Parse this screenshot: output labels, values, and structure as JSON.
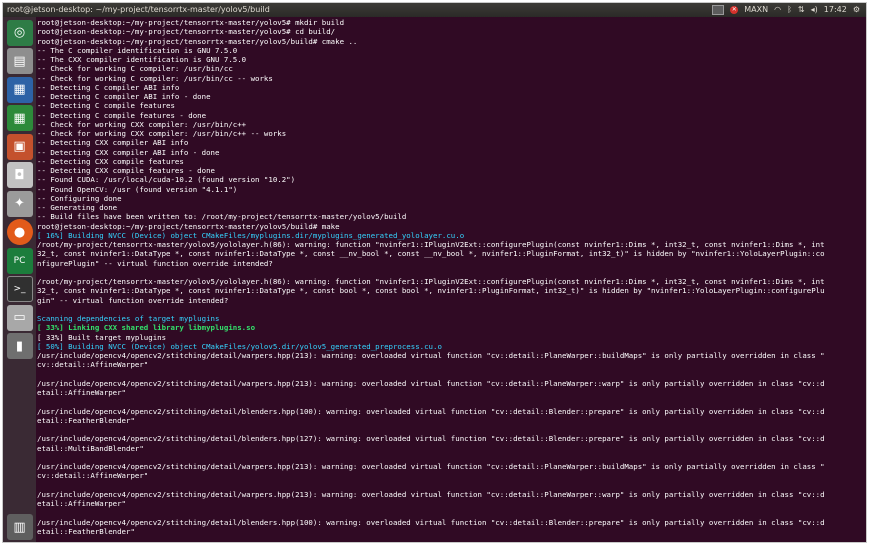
{
  "window": {
    "title": "root@jetson-desktop: ~/my-project/tensorrtx-master/yolov5/build"
  },
  "tray": {
    "mode": "MAXN",
    "time": "17:42",
    "icons": [
      "nvidia-icon",
      "red-status-icon",
      "wifi-icon",
      "bluetooth-icon",
      "keyboard-icon",
      "volume-icon",
      "gear-icon"
    ]
  },
  "launcher": [
    {
      "name": "ubuntu-logo-icon",
      "glyph": "◎"
    },
    {
      "name": "files-icon",
      "glyph": "▤"
    },
    {
      "name": "libreoffice-writer-icon",
      "glyph": "▦"
    },
    {
      "name": "libreoffice-calc-icon",
      "glyph": "▦"
    },
    {
      "name": "libreoffice-impress-icon",
      "glyph": "▣"
    },
    {
      "name": "software-center-icon",
      "glyph": "◘"
    },
    {
      "name": "system-settings-icon",
      "glyph": "✦"
    },
    {
      "name": "firefox-icon",
      "glyph": "●"
    },
    {
      "name": "pycharm-icon",
      "glyph": "PC"
    },
    {
      "name": "terminal-icon",
      "glyph": ">_"
    },
    {
      "name": "drive-icon",
      "glyph": "▭"
    },
    {
      "name": "usb-drive-icon",
      "glyph": "▮"
    },
    {
      "name": "trash-icon",
      "glyph": "▥"
    }
  ],
  "terminal": {
    "lines": [
      {
        "t": "root@jetson-desktop:~/my-project/tensorrtx-master/yolov5# mkdir build",
        "c": ""
      },
      {
        "t": "root@jetson-desktop:~/my-project/tensorrtx-master/yolov5# cd build/",
        "c": ""
      },
      {
        "t": "root@jetson-desktop:~/my-project/tensorrtx-master/yolov5/build# cmake ..",
        "c": ""
      },
      {
        "t": "-- The C compiler identification is GNU 7.5.0",
        "c": ""
      },
      {
        "t": "-- The CXX compiler identification is GNU 7.5.0",
        "c": ""
      },
      {
        "t": "-- Check for working C compiler: /usr/bin/cc",
        "c": ""
      },
      {
        "t": "-- Check for working C compiler: /usr/bin/cc -- works",
        "c": ""
      },
      {
        "t": "-- Detecting C compiler ABI info",
        "c": ""
      },
      {
        "t": "-- Detecting C compiler ABI info - done",
        "c": ""
      },
      {
        "t": "-- Detecting C compile features",
        "c": ""
      },
      {
        "t": "-- Detecting C compile features - done",
        "c": ""
      },
      {
        "t": "-- Check for working CXX compiler: /usr/bin/c++",
        "c": ""
      },
      {
        "t": "-- Check for working CXX compiler: /usr/bin/c++ -- works",
        "c": ""
      },
      {
        "t": "-- Detecting CXX compiler ABI info",
        "c": ""
      },
      {
        "t": "-- Detecting CXX compiler ABI info - done",
        "c": ""
      },
      {
        "t": "-- Detecting CXX compile features",
        "c": ""
      },
      {
        "t": "-- Detecting CXX compile features - done",
        "c": ""
      },
      {
        "t": "-- Found CUDA: /usr/local/cuda-10.2 (found version \"10.2\")",
        "c": ""
      },
      {
        "t": "-- Found OpenCV: /usr (found version \"4.1.1\")",
        "c": ""
      },
      {
        "t": "-- Configuring done",
        "c": ""
      },
      {
        "t": "-- Generating done",
        "c": ""
      },
      {
        "t": "-- Build files have been written to: /root/my-project/tensorrtx-master/yolov5/build",
        "c": ""
      },
      {
        "t": "root@jetson-desktop:~/my-project/tensorrtx-master/yolov5/build# make",
        "c": ""
      },
      {
        "t": "[ 16%] Building NVCC (Device) object CMakeFiles/myplugins.dir/myplugins_generated_yololayer.cu.o",
        "c": "cyan"
      },
      {
        "t": "/root/my-project/tensorrtx-master/yolov5/yololayer.h(86): warning: function \"nvinfer1::IPluginV2Ext::configurePlugin(const nvinfer1::Dims *, int32_t, const nvinfer1::Dims *, int",
        "c": ""
      },
      {
        "t": "32_t, const nvinfer1::DataType *, const nvinfer1::DataType *, const __nv_bool *, const __nv_bool *, nvinfer1::PluginFormat, int32_t)\" is hidden by \"nvinfer1::YoloLayerPlugin::co",
        "c": ""
      },
      {
        "t": "nfigurePlugin\" -- virtual function override intended?",
        "c": ""
      },
      {
        "t": "",
        "c": ""
      },
      {
        "t": "/root/my-project/tensorrtx-master/yolov5/yololayer.h(86): warning: function \"nvinfer1::IPluginV2Ext::configurePlugin(const nvinfer1::Dims *, int32_t, const nvinfer1::Dims *, int",
        "c": ""
      },
      {
        "t": "32_t, const nvinfer1::DataType *, const nvinfer1::DataType *, const bool *, const bool *, nvinfer1::PluginFormat, int32_t)\" is hidden by \"nvinfer1::YoloLayerPlugin::configurePlu",
        "c": ""
      },
      {
        "t": "gin\" -- virtual function override intended?",
        "c": ""
      },
      {
        "t": "",
        "c": ""
      },
      {
        "t": "Scanning dependencies of target myplugins",
        "c": "cyan"
      },
      {
        "t": "[ 33%] Linking CXX shared library libmyplugins.so",
        "c": "green"
      },
      {
        "t": "[ 33%] Built target myplugins",
        "c": ""
      },
      {
        "t": "[ 50%] Building NVCC (Device) object CMakeFiles/yolov5.dir/yolov5_generated_preprocess.cu.o",
        "c": "cyan"
      },
      {
        "t": "/usr/include/opencv4/opencv2/stitching/detail/warpers.hpp(213): warning: overloaded virtual function \"cv::detail::PlaneWarper::buildMaps\" is only partially overridden in class \"",
        "c": ""
      },
      {
        "t": "cv::detail::AffineWarper\"",
        "c": ""
      },
      {
        "t": "",
        "c": ""
      },
      {
        "t": "/usr/include/opencv4/opencv2/stitching/detail/warpers.hpp(213): warning: overloaded virtual function \"cv::detail::PlaneWarper::warp\" is only partially overridden in class \"cv::d",
        "c": ""
      },
      {
        "t": "etail::AffineWarper\"",
        "c": ""
      },
      {
        "t": "",
        "c": ""
      },
      {
        "t": "/usr/include/opencv4/opencv2/stitching/detail/blenders.hpp(100): warning: overloaded virtual function \"cv::detail::Blender::prepare\" is only partially overridden in class \"cv::d",
        "c": ""
      },
      {
        "t": "etail::FeatherBlender\"",
        "c": ""
      },
      {
        "t": "",
        "c": ""
      },
      {
        "t": "/usr/include/opencv4/opencv2/stitching/detail/blenders.hpp(127): warning: overloaded virtual function \"cv::detail::Blender::prepare\" is only partially overridden in class \"cv::d",
        "c": ""
      },
      {
        "t": "etail::MultiBandBlender\"",
        "c": ""
      },
      {
        "t": "",
        "c": ""
      },
      {
        "t": "/usr/include/opencv4/opencv2/stitching/detail/warpers.hpp(213): warning: overloaded virtual function \"cv::detail::PlaneWarper::buildMaps\" is only partially overridden in class \"",
        "c": ""
      },
      {
        "t": "cv::detail::AffineWarper\"",
        "c": ""
      },
      {
        "t": "",
        "c": ""
      },
      {
        "t": "/usr/include/opencv4/opencv2/stitching/detail/warpers.hpp(213): warning: overloaded virtual function \"cv::detail::PlaneWarper::warp\" is only partially overridden in class \"cv::d",
        "c": ""
      },
      {
        "t": "etail::AffineWarper\"",
        "c": ""
      },
      {
        "t": "",
        "c": ""
      },
      {
        "t": "/usr/include/opencv4/opencv2/stitching/detail/blenders.hpp(100): warning: overloaded virtual function \"cv::detail::Blender::prepare\" is only partially overridden in class \"cv::d",
        "c": ""
      },
      {
        "t": "etail::FeatherBlender\"",
        "c": ""
      }
    ]
  }
}
